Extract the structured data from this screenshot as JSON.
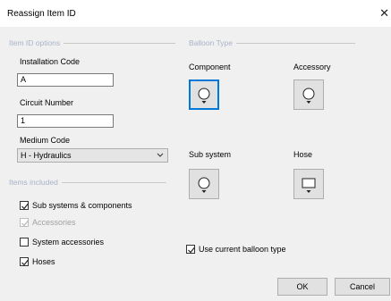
{
  "window": {
    "title": "Reassign Item ID",
    "close_glyph": "✕"
  },
  "item_id_options": {
    "heading": "Item ID options",
    "installation_code": {
      "label": "Installation Code",
      "value": "A"
    },
    "circuit_number": {
      "label": "Circuit Number",
      "value": "1"
    },
    "medium_code": {
      "label": "Medium Code",
      "value": "H - Hydraulics"
    }
  },
  "items_included": {
    "heading": "Items included",
    "options": [
      {
        "label": "Sub systems & components",
        "checked": true,
        "enabled": true
      },
      {
        "label": "Accessories",
        "checked": true,
        "enabled": false
      },
      {
        "label": "System accessories",
        "checked": false,
        "enabled": true
      },
      {
        "label": "Hoses",
        "checked": true,
        "enabled": true
      }
    ]
  },
  "balloon_type": {
    "heading": "Balloon Type",
    "types": [
      {
        "label": "Component",
        "icon": "circle-balloon-icon",
        "selected": true
      },
      {
        "label": "Accessory",
        "icon": "circle-balloon-icon",
        "selected": false
      },
      {
        "label": "Sub system",
        "icon": "circle-balloon-icon",
        "selected": false
      },
      {
        "label": "Hose",
        "icon": "rectangle-balloon-icon",
        "selected": false
      }
    ],
    "use_current": {
      "label": "Use current balloon type",
      "checked": true
    }
  },
  "buttons": {
    "ok": "OK",
    "cancel": "Cancel"
  },
  "colors": {
    "selected_border": "#0078d7",
    "group_heading": "#a7b3c8"
  }
}
